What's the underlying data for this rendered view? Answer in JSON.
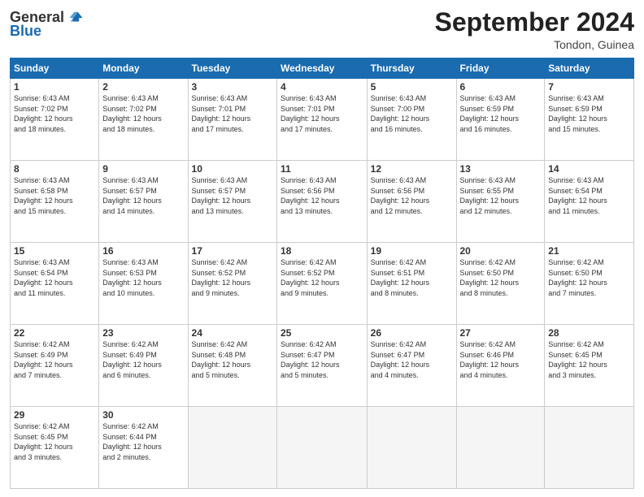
{
  "header": {
    "logo_line1": "General",
    "logo_line2": "Blue",
    "month_title": "September 2024",
    "location": "Tondon, Guinea"
  },
  "weekdays": [
    "Sunday",
    "Monday",
    "Tuesday",
    "Wednesday",
    "Thursday",
    "Friday",
    "Saturday"
  ],
  "weeks": [
    [
      {
        "day": "1",
        "info": "Sunrise: 6:43 AM\nSunset: 7:02 PM\nDaylight: 12 hours\nand 18 minutes."
      },
      {
        "day": "2",
        "info": "Sunrise: 6:43 AM\nSunset: 7:02 PM\nDaylight: 12 hours\nand 18 minutes."
      },
      {
        "day": "3",
        "info": "Sunrise: 6:43 AM\nSunset: 7:01 PM\nDaylight: 12 hours\nand 17 minutes."
      },
      {
        "day": "4",
        "info": "Sunrise: 6:43 AM\nSunset: 7:01 PM\nDaylight: 12 hours\nand 17 minutes."
      },
      {
        "day": "5",
        "info": "Sunrise: 6:43 AM\nSunset: 7:00 PM\nDaylight: 12 hours\nand 16 minutes."
      },
      {
        "day": "6",
        "info": "Sunrise: 6:43 AM\nSunset: 6:59 PM\nDaylight: 12 hours\nand 16 minutes."
      },
      {
        "day": "7",
        "info": "Sunrise: 6:43 AM\nSunset: 6:59 PM\nDaylight: 12 hours\nand 15 minutes."
      }
    ],
    [
      {
        "day": "8",
        "info": "Sunrise: 6:43 AM\nSunset: 6:58 PM\nDaylight: 12 hours\nand 15 minutes."
      },
      {
        "day": "9",
        "info": "Sunrise: 6:43 AM\nSunset: 6:57 PM\nDaylight: 12 hours\nand 14 minutes."
      },
      {
        "day": "10",
        "info": "Sunrise: 6:43 AM\nSunset: 6:57 PM\nDaylight: 12 hours\nand 13 minutes."
      },
      {
        "day": "11",
        "info": "Sunrise: 6:43 AM\nSunset: 6:56 PM\nDaylight: 12 hours\nand 13 minutes."
      },
      {
        "day": "12",
        "info": "Sunrise: 6:43 AM\nSunset: 6:56 PM\nDaylight: 12 hours\nand 12 minutes."
      },
      {
        "day": "13",
        "info": "Sunrise: 6:43 AM\nSunset: 6:55 PM\nDaylight: 12 hours\nand 12 minutes."
      },
      {
        "day": "14",
        "info": "Sunrise: 6:43 AM\nSunset: 6:54 PM\nDaylight: 12 hours\nand 11 minutes."
      }
    ],
    [
      {
        "day": "15",
        "info": "Sunrise: 6:43 AM\nSunset: 6:54 PM\nDaylight: 12 hours\nand 11 minutes."
      },
      {
        "day": "16",
        "info": "Sunrise: 6:43 AM\nSunset: 6:53 PM\nDaylight: 12 hours\nand 10 minutes."
      },
      {
        "day": "17",
        "info": "Sunrise: 6:42 AM\nSunset: 6:52 PM\nDaylight: 12 hours\nand 9 minutes."
      },
      {
        "day": "18",
        "info": "Sunrise: 6:42 AM\nSunset: 6:52 PM\nDaylight: 12 hours\nand 9 minutes."
      },
      {
        "day": "19",
        "info": "Sunrise: 6:42 AM\nSunset: 6:51 PM\nDaylight: 12 hours\nand 8 minutes."
      },
      {
        "day": "20",
        "info": "Sunrise: 6:42 AM\nSunset: 6:50 PM\nDaylight: 12 hours\nand 8 minutes."
      },
      {
        "day": "21",
        "info": "Sunrise: 6:42 AM\nSunset: 6:50 PM\nDaylight: 12 hours\nand 7 minutes."
      }
    ],
    [
      {
        "day": "22",
        "info": "Sunrise: 6:42 AM\nSunset: 6:49 PM\nDaylight: 12 hours\nand 7 minutes."
      },
      {
        "day": "23",
        "info": "Sunrise: 6:42 AM\nSunset: 6:49 PM\nDaylight: 12 hours\nand 6 minutes."
      },
      {
        "day": "24",
        "info": "Sunrise: 6:42 AM\nSunset: 6:48 PM\nDaylight: 12 hours\nand 5 minutes."
      },
      {
        "day": "25",
        "info": "Sunrise: 6:42 AM\nSunset: 6:47 PM\nDaylight: 12 hours\nand 5 minutes."
      },
      {
        "day": "26",
        "info": "Sunrise: 6:42 AM\nSunset: 6:47 PM\nDaylight: 12 hours\nand 4 minutes."
      },
      {
        "day": "27",
        "info": "Sunrise: 6:42 AM\nSunset: 6:46 PM\nDaylight: 12 hours\nand 4 minutes."
      },
      {
        "day": "28",
        "info": "Sunrise: 6:42 AM\nSunset: 6:45 PM\nDaylight: 12 hours\nand 3 minutes."
      }
    ],
    [
      {
        "day": "29",
        "info": "Sunrise: 6:42 AM\nSunset: 6:45 PM\nDaylight: 12 hours\nand 3 minutes."
      },
      {
        "day": "30",
        "info": "Sunrise: 6:42 AM\nSunset: 6:44 PM\nDaylight: 12 hours\nand 2 minutes."
      },
      {
        "day": "",
        "info": ""
      },
      {
        "day": "",
        "info": ""
      },
      {
        "day": "",
        "info": ""
      },
      {
        "day": "",
        "info": ""
      },
      {
        "day": "",
        "info": ""
      }
    ]
  ]
}
